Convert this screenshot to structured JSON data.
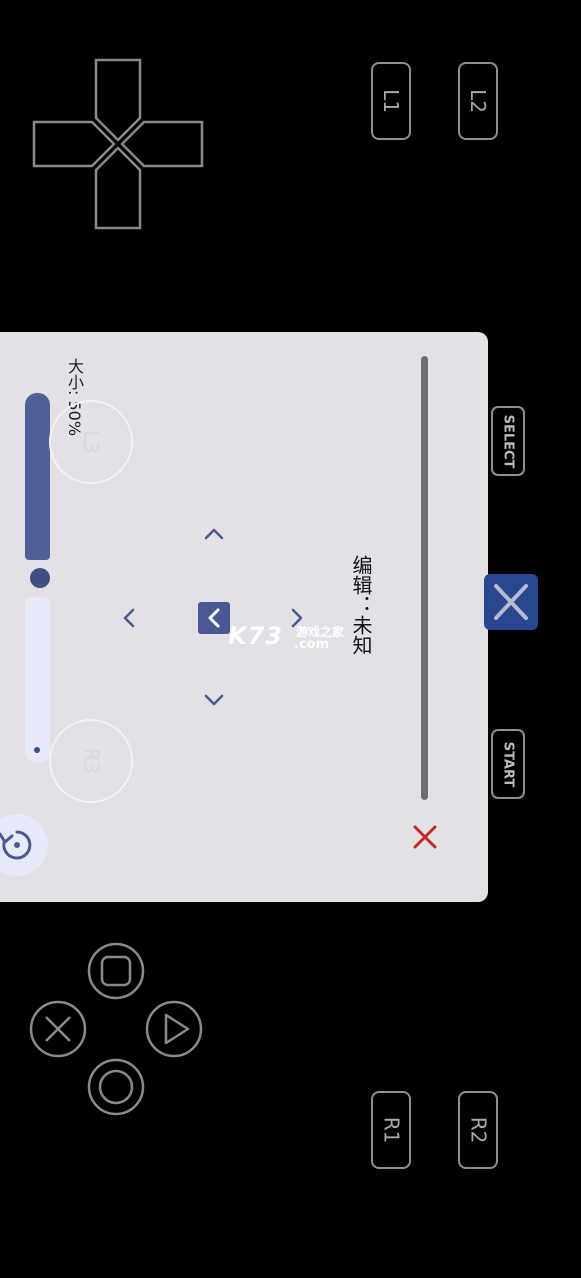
{
  "shoulder_buttons": {
    "l1": "L1",
    "l2": "L2",
    "r1": "R1",
    "r2": "R2"
  },
  "system_buttons": {
    "select": "SELECT",
    "start": "START"
  },
  "edit_panel": {
    "title": "编辑：未知",
    "size_label": "大小: 50%",
    "size_value": 0.5,
    "ghost_sticks": {
      "l3": "L3",
      "r3": "R3"
    }
  },
  "watermark": {
    "brand": "K73",
    "site_suffix": ".com",
    "site_name": "游戏之家"
  },
  "colors": {
    "panel_bg": "#e3e0e6",
    "slider_fill": "#4f5f97",
    "close_red": "#c62828",
    "accent_blue": "#2a4690"
  }
}
